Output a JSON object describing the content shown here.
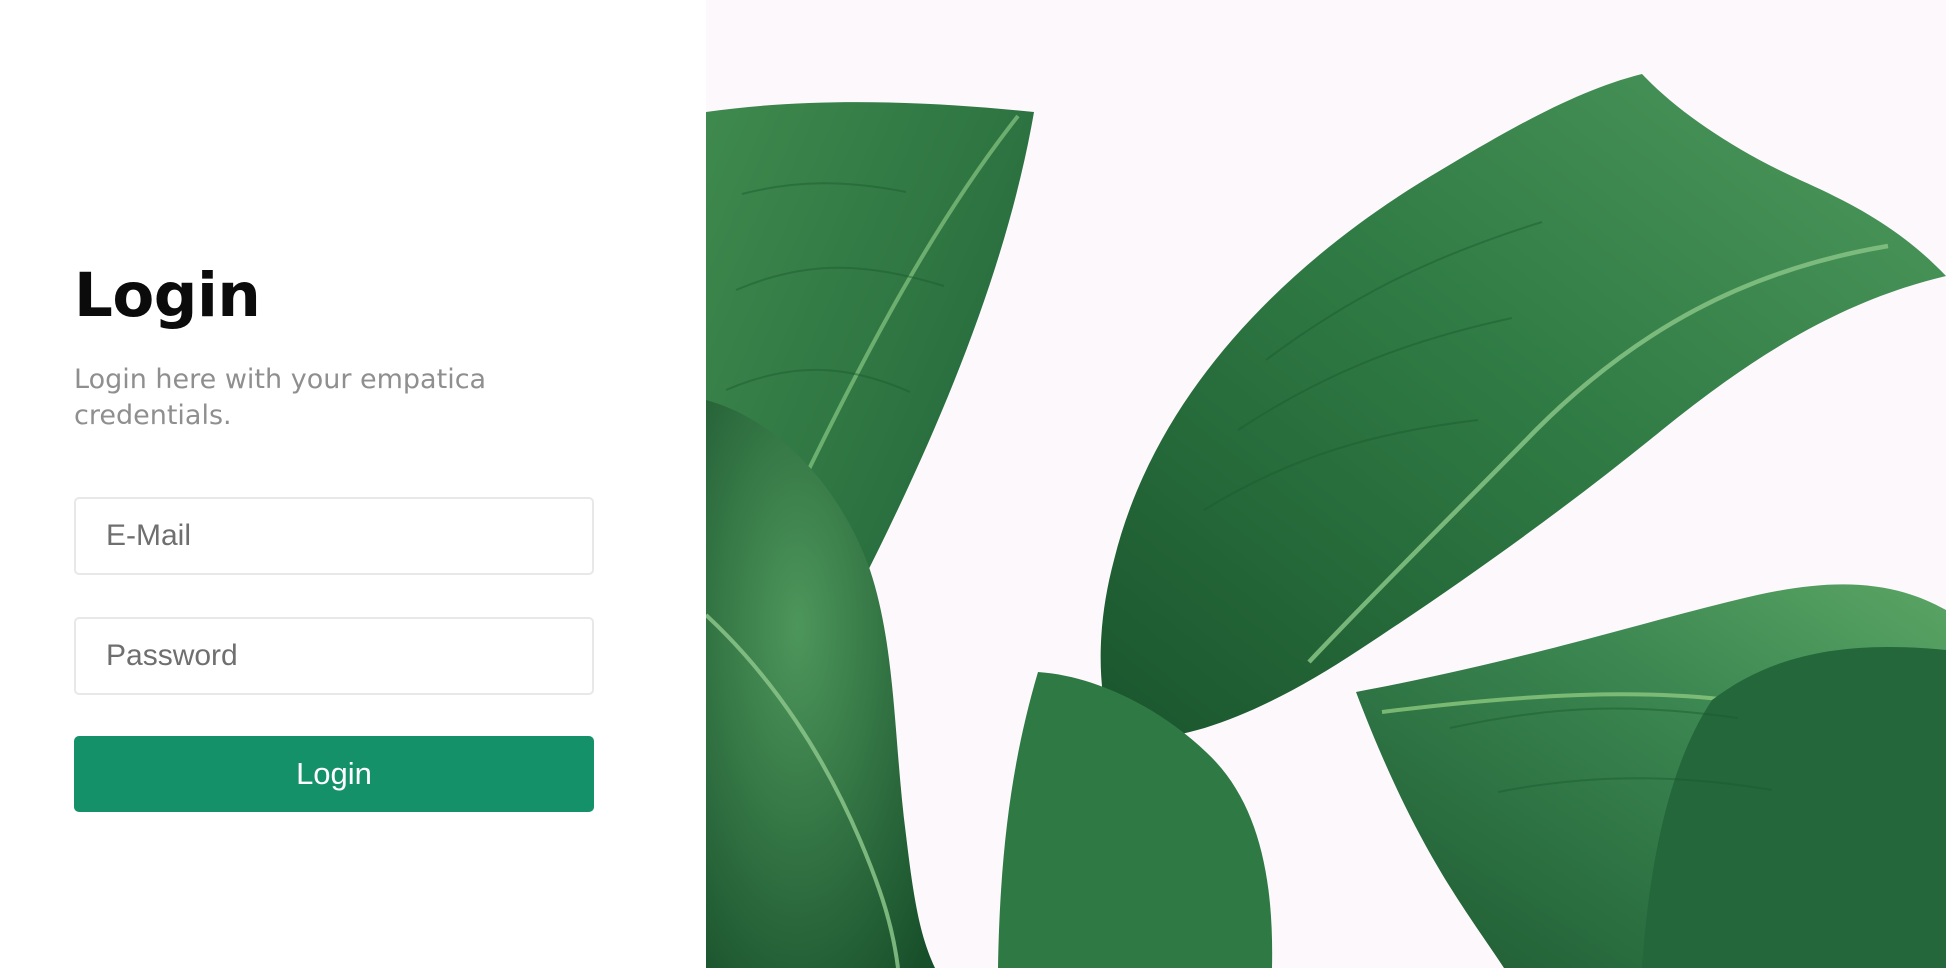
{
  "login": {
    "title": "Login",
    "subtitle": "Login here with your empatica credentials.",
    "email_placeholder": "E-Mail",
    "password_placeholder": "Password",
    "button_label": "Login"
  },
  "colors": {
    "accent": "#15916a",
    "background_right": "#fcf8fc",
    "leaf_dark": "#1f5c32",
    "leaf_mid": "#2f7a44",
    "leaf_light": "#4f9a5d"
  },
  "image": {
    "icon": "leaves-photo"
  }
}
